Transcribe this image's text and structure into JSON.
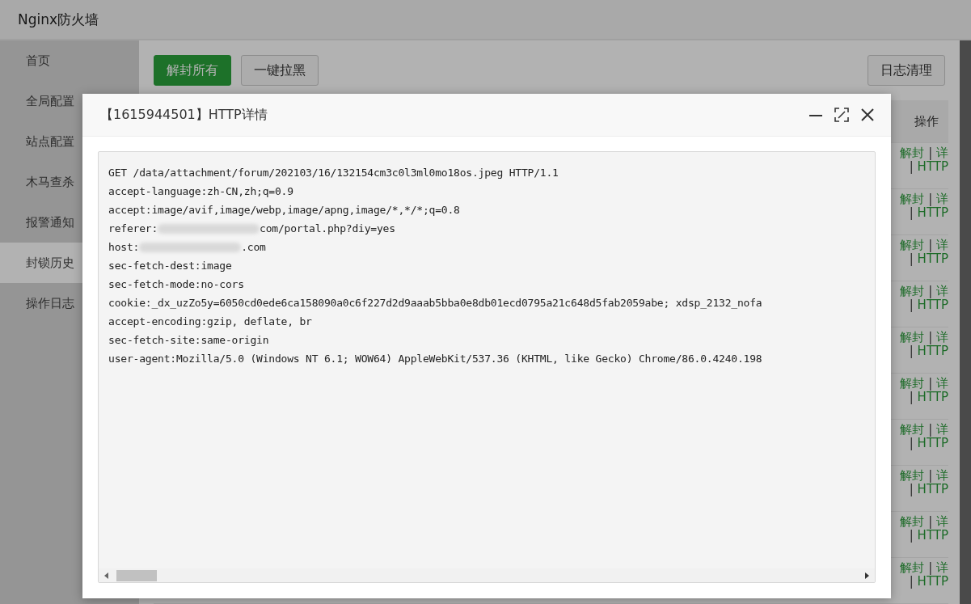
{
  "app": {
    "title": "Nginx防火墙"
  },
  "sidebar": {
    "items": [
      {
        "label": "首页",
        "selected": false
      },
      {
        "label": "全局配置",
        "selected": false
      },
      {
        "label": "站点配置",
        "selected": false
      },
      {
        "label": "木马查杀",
        "selected": false
      },
      {
        "label": "报警通知",
        "selected": false
      },
      {
        "label": "封锁历史",
        "selected": true
      },
      {
        "label": "操作日志",
        "selected": false
      }
    ]
  },
  "toolbar": {
    "buttons": [
      {
        "label": "解封所有",
        "kind": "primary"
      },
      {
        "label": "一键拉黑",
        "kind": "default"
      },
      {
        "label": "日志清理",
        "kind": "right"
      }
    ]
  },
  "table": {
    "action_column": "操作",
    "rows": [
      {
        "unblock": "解封",
        "separator": "|",
        "detail": "详",
        "http": "HTTP"
      },
      {
        "unblock": "解封",
        "separator": "|",
        "detail": "详",
        "http": "HTTP"
      },
      {
        "unblock": "解封",
        "separator": "|",
        "detail": "详",
        "http": "HTTP"
      },
      {
        "unblock": "解封",
        "separator": "|",
        "detail": "详",
        "http": "HTTP"
      },
      {
        "unblock": "解封",
        "separator": "|",
        "detail": "详",
        "http": "HTTP"
      },
      {
        "unblock": "解封",
        "separator": "|",
        "detail": "详",
        "http": "HTTP"
      },
      {
        "unblock": "解封",
        "separator": "|",
        "detail": "详",
        "http": "HTTP"
      },
      {
        "unblock": "解封",
        "separator": "|",
        "detail": "详",
        "http": "HTTP"
      },
      {
        "unblock": "解封",
        "separator": "|",
        "detail": "详",
        "http": "HTTP"
      },
      {
        "unblock": "解封",
        "separator": "|",
        "detail": "详",
        "http": "HTTP"
      }
    ]
  },
  "dialog": {
    "title": "【1615944501】HTTP详情",
    "lines": [
      {
        "text": "GET /data/attachment/forum/202103/16/132154cm3c0l3ml0mo18os.jpeg HTTP/1.1"
      },
      {
        "text": "accept-language:zh-CN,zh;q=0.9"
      },
      {
        "text": "accept:image/avif,image/webp,image/apng,image/*,*/*;q=0.8"
      },
      {
        "text": "referer:",
        "blurred": true,
        "after": "com/portal.php?diy=yes"
      },
      {
        "text": "host:",
        "blurred": true,
        "after": ".com"
      },
      {
        "text": "sec-fetch-dest:image"
      },
      {
        "text": "sec-fetch-mode:no-cors"
      },
      {
        "text": "cookie:_dx_uzZo5y=6050cd0ede6ca158090a0c6f227d2d9aaab5bba0e8db01ecd0795a21c648d5fab2059abe; xdsp_2132_nofa"
      },
      {
        "text": "accept-encoding:gzip, deflate, br"
      },
      {
        "text": "sec-fetch-site:same-origin"
      },
      {
        "text": "user-agent:Mozilla/5.0 (Windows NT 6.1; WOW64) AppleWebKit/537.36 (KHTML, like Gecko) Chrome/86.0.4240.198"
      }
    ]
  }
}
